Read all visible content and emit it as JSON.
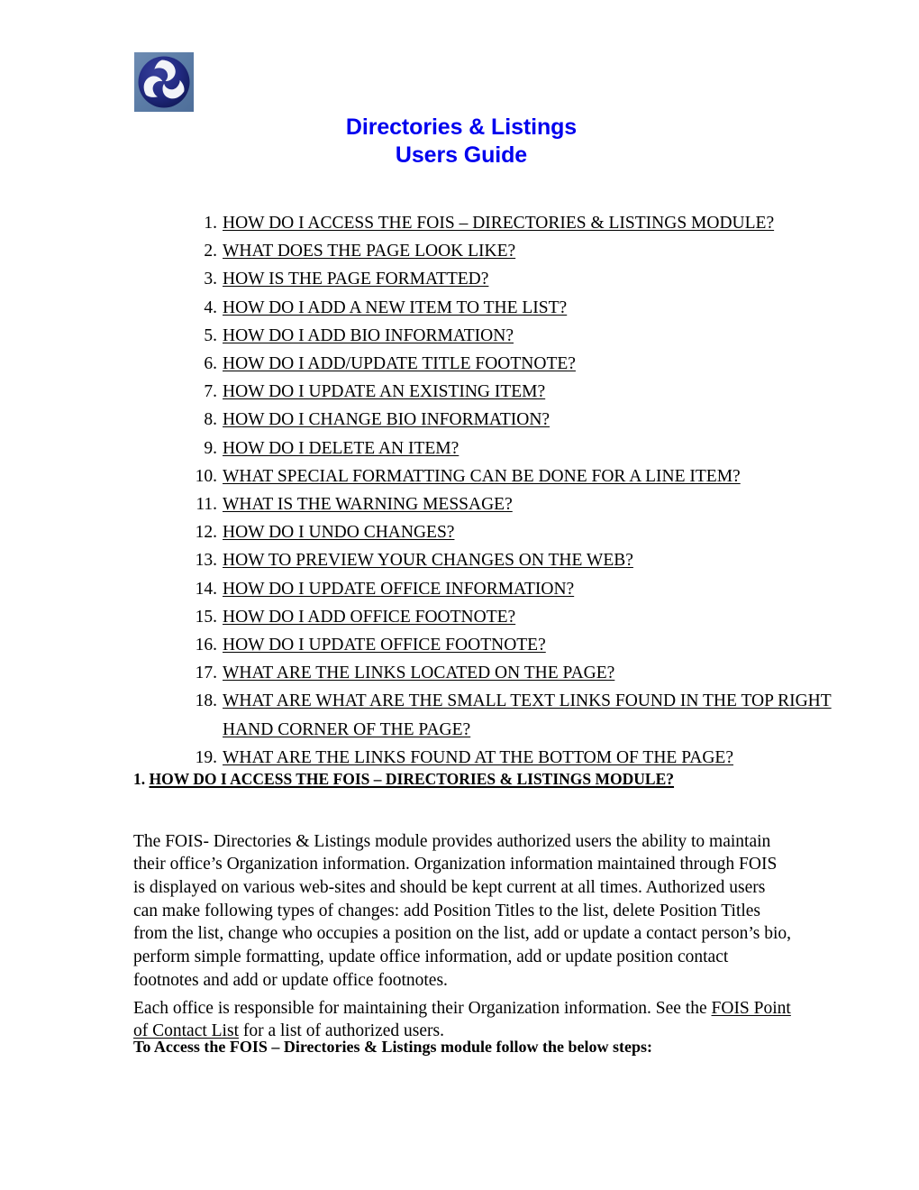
{
  "document": {
    "title_lines": [
      "Directories & Listings",
      "Users Guide"
    ],
    "title_color": "#0000EE",
    "logo": {
      "name": "dot-triskelion-logo",
      "background_color": "#5A7BA6",
      "circle_color": "#1F2A7A",
      "mark_color": "#FFFFFF"
    }
  },
  "toc": {
    "items": [
      {
        "num": "1.",
        "label": "HOW DO I ACCESS THE FOIS – DIRECTORIES & LISTINGS MODULE? "
      },
      {
        "num": "2.",
        "label": "WHAT DOES THE PAGE LOOK LIKE? "
      },
      {
        "num": "3.",
        "label": "HOW IS THE PAGE FORMATTED?"
      },
      {
        "num": "4.",
        "label": "HOW DO I ADD A NEW ITEM TO THE LIST?"
      },
      {
        "num": "5.",
        "label": "HOW DO I ADD BIO INFORMATION? "
      },
      {
        "num": "6.",
        "label": "HOW DO I ADD/UPDATE TITLE FOOTNOTE? "
      },
      {
        "num": "7.",
        "label": "HOW DO I UPDATE AN EXISTING ITEM? "
      },
      {
        "num": "8.",
        "label": "HOW DO I CHANGE BIO INFORMATION? "
      },
      {
        "num": "9.",
        "label": "HOW DO I DELETE AN ITEM? "
      },
      {
        "num": "10.",
        "label": "WHAT SPECIAL FORMATTING CAN BE DONE FOR A LINE ITEM? "
      },
      {
        "num": "11.",
        "label": "WHAT IS THE WARNING MESSAGE? "
      },
      {
        "num": "12.",
        "label": "HOW DO I UNDO CHANGES? "
      },
      {
        "num": "13.",
        "label": "HOW TO PREVIEW YOUR CHANGES ON THE WEB? "
      },
      {
        "num": "14.",
        "label": "HOW DO I UPDATE OFFICE INFORMATION? "
      },
      {
        "num": "15.",
        "label": "HOW DO I ADD OFFICE FOOTNOTE? "
      },
      {
        "num": "16.",
        "label": "HOW DO I UPDATE OFFICE FOOTNOTE? "
      },
      {
        "num": "17.",
        "label": "WHAT ARE THE LINKS LOCATED ON THE PAGE? "
      },
      {
        "num": "18.",
        "label": "WHAT ARE WHAT ARE THE SMALL TEXT LINKS FOUND IN THE TOP RIGHT HAND CORNER OF THE PAGE?  "
      },
      {
        "num": "19.",
        "label": "WHAT ARE THE LINKS FOUND AT THE BOTTOM OF THE PAGE? "
      }
    ]
  },
  "section_1": {
    "heading_number": "1. ",
    "heading_text": "HOW DO I ACCESS THE FOIS – DIRECTORIES & LISTINGS MODULE? ",
    "paragraph_intro": "The FOIS- Directories & Listings module provides authorized users the ability to maintain their office’s Organization information.  Organization information maintained through FOIS is displayed on various web-sites and should be kept current at all times.  Authorized users can make following types of changes: add Position Titles to the list, delete Position Titles from the list, change who occupies a position on the list, add or update a contact person’s bio, perform simple formatting, update office information, add or update position contact footnotes and add or update office footnotes.",
    "paragraph_each_before": "Each office is responsible for maintaining their Organization information.   See the ",
    "paragraph_each_link": "FOIS Point of Contact List",
    "paragraph_each_after": " for a list of authorized users.",
    "steps_lead_in": "To Access the FOIS – Directories & Listings module follow the below steps:"
  }
}
